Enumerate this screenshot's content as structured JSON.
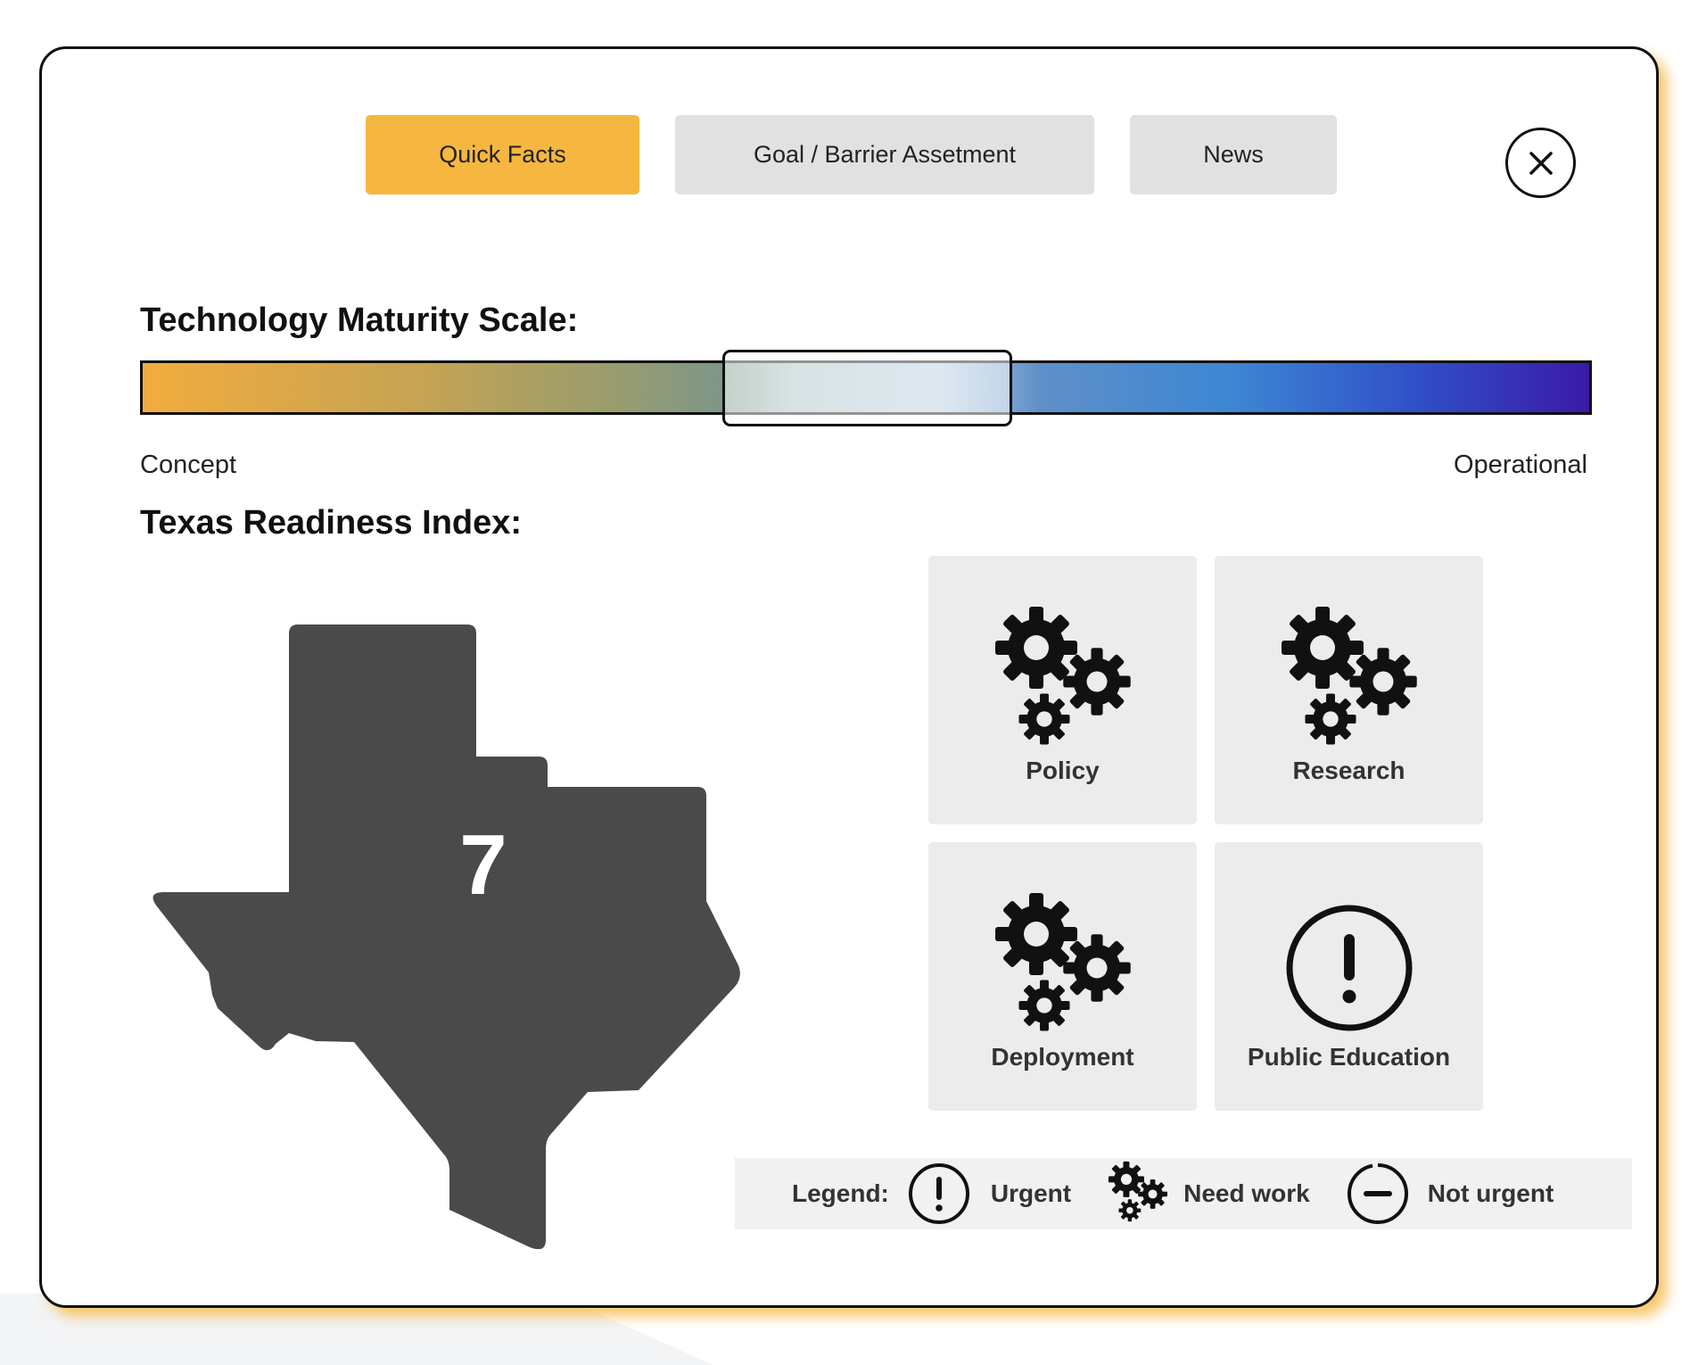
{
  "tabs": [
    {
      "label": "Quick Facts",
      "active": true
    },
    {
      "label": "Goal / Barrier Assetment",
      "active": false
    },
    {
      "label": "News",
      "active": false
    }
  ],
  "close_icon": "close-icon",
  "maturity": {
    "title": "Technology Maturity Scale:",
    "left_label": "Concept",
    "right_label": "Operational"
  },
  "readiness": {
    "title": "Texas Readiness Index:",
    "value": "7"
  },
  "cards": [
    {
      "label": "Policy",
      "icon": "gears-icon"
    },
    {
      "label": "Research",
      "icon": "gears-icon"
    },
    {
      "label": "Deployment",
      "icon": "gears-icon"
    },
    {
      "label": "Public Education",
      "icon": "exclamation-circle-icon"
    }
  ],
  "legend": {
    "title": "Legend:",
    "items": [
      {
        "label": "Urgent",
        "icon": "exclamation-circle-icon"
      },
      {
        "label": "Need work",
        "icon": "gears-icon"
      },
      {
        "label": "Not urgent",
        "icon": "minus-circle-icon"
      }
    ]
  },
  "colors": {
    "active_tab": "#f5b73f",
    "inactive_tab": "#e1e1e1",
    "texas_fill": "#4a4a4a",
    "card_bg": "#ececec",
    "modal_shadow": "#f5b740"
  }
}
